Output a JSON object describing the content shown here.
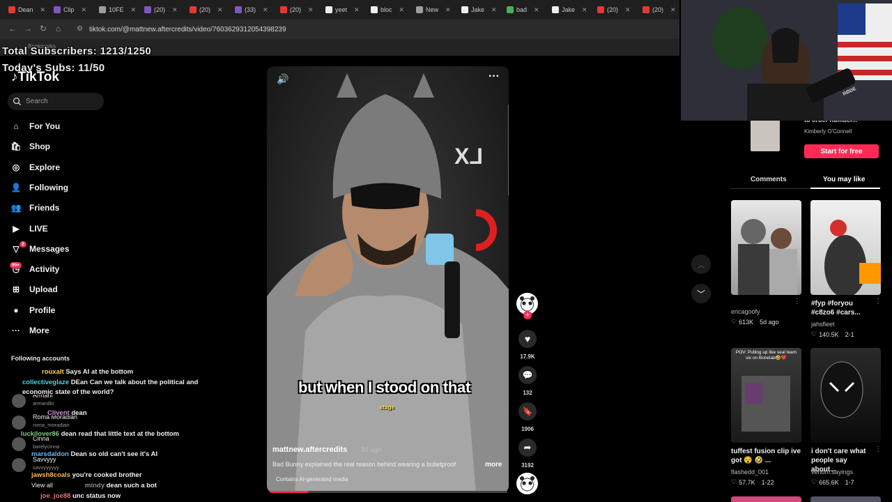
{
  "browser": {
    "tabs": [
      {
        "label": "Dean",
        "color": "#e53935"
      },
      {
        "label": "Clip",
        "color": "#7e57c2"
      },
      {
        "label": "10FE",
        "color": "#9e9e9e"
      },
      {
        "label": "(20)",
        "color": "#7e57c2"
      },
      {
        "label": "(20)",
        "color": "#e53935"
      },
      {
        "label": "(33)",
        "color": "#7e57c2"
      },
      {
        "label": "(20)",
        "color": "#e53935"
      },
      {
        "label": "yeet",
        "color": "#eeeeee"
      },
      {
        "label": "bloc",
        "color": "#eeeeee"
      },
      {
        "label": "New",
        "color": "#9e9e9e"
      },
      {
        "label": "Jake",
        "color": "#eeeeee"
      },
      {
        "label": "bad",
        "color": "#4caf50"
      },
      {
        "label": "Jake",
        "color": "#eeeeee"
      },
      {
        "label": "(20)",
        "color": "#e53935"
      },
      {
        "label": "(20)",
        "color": "#e53935"
      }
    ],
    "url": "tiktok.com/@mattnew.aftercredits/video/7603629312054398239",
    "bookmarks_label": "Bookmarks"
  },
  "overlay": {
    "total_subs": "Total Subscribers: 1213/1250",
    "today_subs": "Today's Subs: 11/50"
  },
  "tiktok": {
    "logo": "TikTok",
    "search_placeholder": "Search",
    "nav": [
      {
        "label": "For You",
        "icon": "home-icon"
      },
      {
        "label": "Shop",
        "icon": "shop-icon"
      },
      {
        "label": "Explore",
        "icon": "compass-icon"
      },
      {
        "label": "Following",
        "icon": "following-icon"
      },
      {
        "label": "Friends",
        "icon": "friends-icon"
      },
      {
        "label": "LIVE",
        "icon": "live-icon"
      },
      {
        "label": "Messages",
        "icon": "messages-icon"
      },
      {
        "label": "Activity",
        "icon": "activity-icon"
      },
      {
        "label": "Upload",
        "icon": "upload-icon"
      },
      {
        "label": "Profile",
        "icon": "profile-icon"
      },
      {
        "label": "More",
        "icon": "more-icon"
      }
    ],
    "messages_badge": "2",
    "activity_badge": "99+",
    "following_accounts_label": "Following accounts",
    "accounts": [
      {
        "name": "Armani",
        "handle": "armanillo"
      },
      {
        "name": "Roma Moradian",
        "handle": "roma_moradian"
      },
      {
        "name": "Cinna",
        "handle": "barelycinna"
      },
      {
        "name": "Savvyyy",
        "handle": "savvyyyyyy"
      },
      {
        "name": "View all",
        "handle": ""
      }
    ]
  },
  "chat": [
    {
      "user": "rouxalt",
      "user_color": "#ffd54f",
      "msg": "Says AI at the bottom"
    },
    {
      "user": "collectiveglaze",
      "user_color": "#4dd0e1",
      "msg": "DEan Can we talk about the political and economic state of the world?"
    },
    {
      "user": "Clivent",
      "user_color": "#ce93d8",
      "msg": "dean"
    },
    {
      "user": "luckilover86",
      "user_color": "#81c784",
      "msg": "dean read that little text at the bottom"
    },
    {
      "user": "marsdaldon",
      "user_color": "#64b5f6",
      "msg": "Dean so old can't see it's AI"
    },
    {
      "user": "jawsh8coals",
      "user_color": "#ffb74d",
      "msg": "you're cooked brother"
    },
    {
      "user": "mindy",
      "user_color": "#a1887f",
      "msg": "dean such a bot"
    },
    {
      "user": "joe_joe88",
      "user_color": "#e57373",
      "msg": "unc status now"
    }
  ],
  "video": {
    "caption": "but when I stood on that",
    "caption_sub": "stage",
    "author": "mattnew.aftercredits",
    "date": "· 3d ago",
    "description": "Bad Bunny explained the real reason behind wearing a bulletproof",
    "more": "more",
    "ai_label": "Contains AI-generated media",
    "progress": 0.16,
    "likes": "17.9K",
    "comments": "132",
    "saves": "1906",
    "shares": "3192"
  },
  "right_panel": {
    "ad_title": "to order number...",
    "ad_author": "Kimberly O'Connell",
    "ad_cta": "Start for free",
    "tabs": [
      "Comments",
      "You may like"
    ],
    "active_tab": "You may like",
    "recs": [
      {
        "title": "",
        "author": "ericagoofy",
        "likes": "613K",
        "date": "5d ago"
      },
      {
        "title": "#fyp #foryou #c8zo6 #cars...",
        "author": "jahsfleet",
        "likes": "140.5K",
        "date": "2-1"
      },
      {
        "title": "tuffest fusion clip ive got 😵 🤣 ...",
        "author": "flashedd_001",
        "likes": "57.7K",
        "date": "1-22",
        "overlay": "POV: Pulling up like seal team six on Bonelab🤣❤️"
      },
      {
        "title": "i don't care what people say about...",
        "author": "venom.sayings",
        "likes": "665.6K",
        "date": "1-7"
      }
    ]
  },
  "webcam": {
    "mic_label": "RØDE"
  }
}
